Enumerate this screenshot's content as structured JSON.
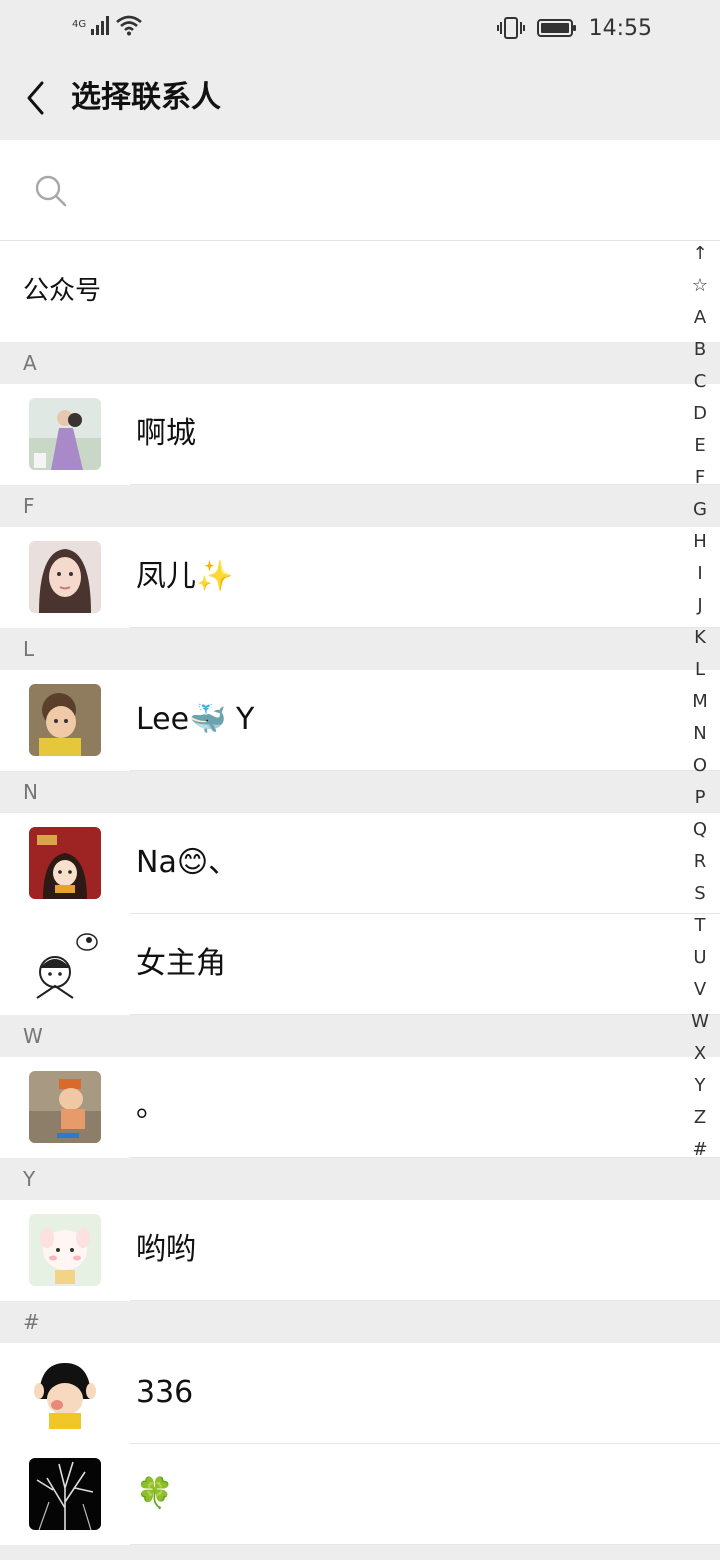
{
  "status_bar": {
    "network": "4G",
    "time": "14:55"
  },
  "header": {
    "title": "选择联系人"
  },
  "search": {
    "placeholder": ""
  },
  "official_accounts": {
    "label": "公众号"
  },
  "sections": [
    {
      "letter": "A",
      "contacts": [
        {
          "name": "啊城",
          "avatar": "photo-couple"
        }
      ]
    },
    {
      "letter": "F",
      "contacts": [
        {
          "name": "凤儿✨",
          "avatar": "photo-woman"
        }
      ]
    },
    {
      "letter": "L",
      "contacts": [
        {
          "name": "Lee🐳 Y",
          "avatar": "photo-child"
        }
      ]
    },
    {
      "letter": "N",
      "contacts": [
        {
          "name": "Na😊、",
          "avatar": "cartoon-girl-red"
        },
        {
          "name": "女主角",
          "avatar": "cartoon-boy-sketch"
        }
      ]
    },
    {
      "letter": "W",
      "contacts": [
        {
          "name": "。",
          "avatar": "photo-beach-child"
        }
      ]
    },
    {
      "letter": "Y",
      "contacts": [
        {
          "name": "哟哟",
          "avatar": "cartoon-bunny"
        }
      ]
    },
    {
      "letter": "#",
      "contacts": [
        {
          "name": "336",
          "avatar": "cartoon-maruko"
        },
        {
          "name": "🍀",
          "avatar": "photo-tree-dark"
        }
      ]
    }
  ],
  "index_bar": [
    "↑",
    "☆",
    "A",
    "B",
    "C",
    "D",
    "E",
    "F",
    "G",
    "H",
    "I",
    "J",
    "K",
    "L",
    "M",
    "N",
    "O",
    "P",
    "Q",
    "R",
    "S",
    "T",
    "U",
    "V",
    "W",
    "X",
    "Y",
    "Z",
    "#"
  ]
}
